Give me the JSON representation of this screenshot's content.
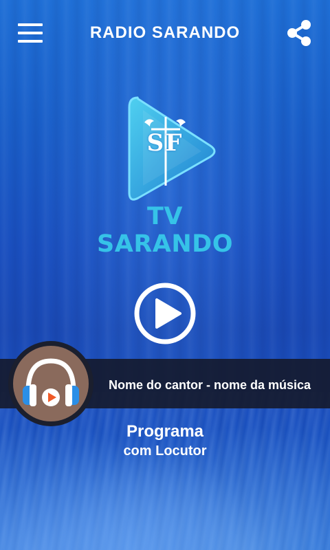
{
  "header": {
    "title": "RADIO SARANDO",
    "menu_icon": "hamburger-menu-icon",
    "share_icon": "share-icon"
  },
  "logo": {
    "monogram": "SF",
    "brand_text": "TV SARANDO"
  },
  "player": {
    "play_icon": "play-icon",
    "now_playing": "Nome do cantor - nome da música",
    "program_title": "Programa",
    "program_host": "com Locutor",
    "album_icon": "headphones-icon"
  },
  "colors": {
    "accent": "#36c3e8",
    "background": "#1a4fbf",
    "bar": "#14182a",
    "avatar": "#8a6a5c",
    "headphone_blue": "#2b8fe8",
    "headphone_orange": "#f05a28"
  }
}
